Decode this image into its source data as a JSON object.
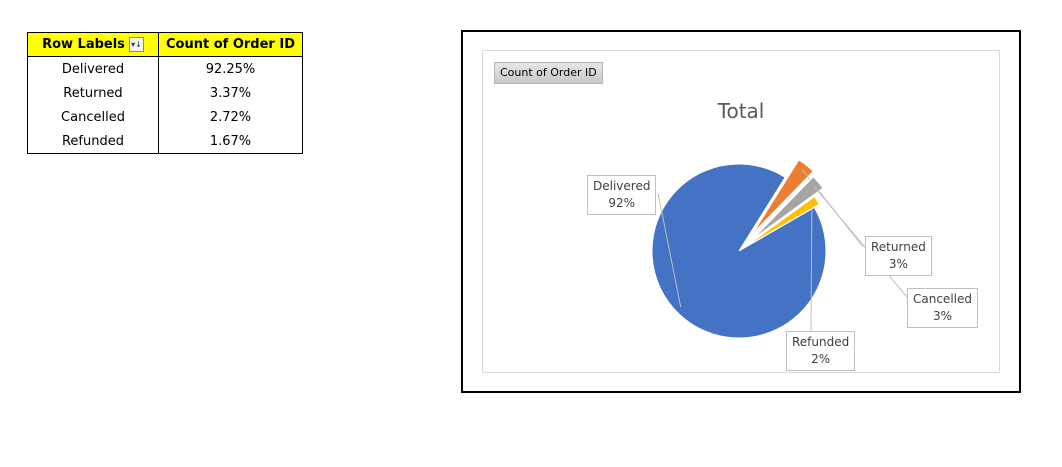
{
  "pivot_table": {
    "header_row_labels": "Row Labels",
    "header_count": "Count of Order ID",
    "sort_icon": "sort-desc-icon",
    "rows": [
      {
        "label": "Delivered",
        "value": "92.25%"
      },
      {
        "label": "Returned",
        "value": "3.37%"
      },
      {
        "label": "Cancelled",
        "value": "2.72%"
      },
      {
        "label": "Refunded",
        "value": "1.67%"
      }
    ]
  },
  "chart": {
    "field_button": "Count of Order ID",
    "title": "Total",
    "colors": {
      "Delivered": "#4472c4",
      "Returned": "#ed7d31",
      "Cancelled": "#a5a5a5",
      "Refunded": "#ffc000"
    }
  },
  "chart_data": {
    "type": "pie",
    "title": "Total",
    "categories": [
      "Delivered",
      "Returned",
      "Cancelled",
      "Refunded"
    ],
    "values": [
      92.25,
      3.37,
      2.72,
      1.67
    ],
    "data_labels": [
      "92%",
      "3%",
      "3%",
      "2%"
    ],
    "legend": "none"
  }
}
